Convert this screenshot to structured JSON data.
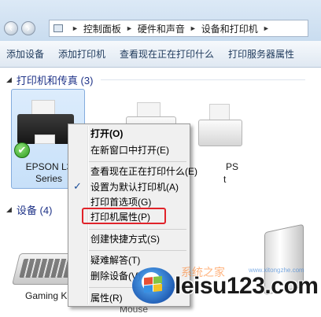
{
  "address_bar": {
    "crumbs": [
      "控制面板",
      "硬件和声音",
      "设备和打印机"
    ]
  },
  "toolbar": {
    "buttons": [
      "添加设备",
      "添加打印机",
      "查看现在正在打印什么",
      "打印服务器属性"
    ]
  },
  "groups": {
    "printers": "打印机和传真 (3)",
    "devices": "设备 (4)"
  },
  "devices": {
    "epson_label": "EPSON L3",
    "epson_label_2": "Series",
    "partial_eps": "PS",
    "partial_t": "t",
    "keyboard_label": "Gaming K",
    "mouse_label": "Mouse"
  },
  "context_menu": {
    "items": [
      "打开(O)",
      "在新窗口中打开(E)",
      "查看现在正在打印什么(E)",
      "设置为默认打印机(A)",
      "打印首选项(G)",
      "打印机属性(P)",
      "创建快捷方式(S)",
      "疑难解答(T)",
      "删除设备(V)",
      "属性(R)"
    ]
  },
  "watermark": {
    "text": "leisu123.com",
    "faint_text": "系统之家",
    "faint_url": "www.xitongzhe.com"
  },
  "colors": {
    "highlight": "#e0232a",
    "selection": "#c7e0f9",
    "group_header": "#1e3287"
  }
}
